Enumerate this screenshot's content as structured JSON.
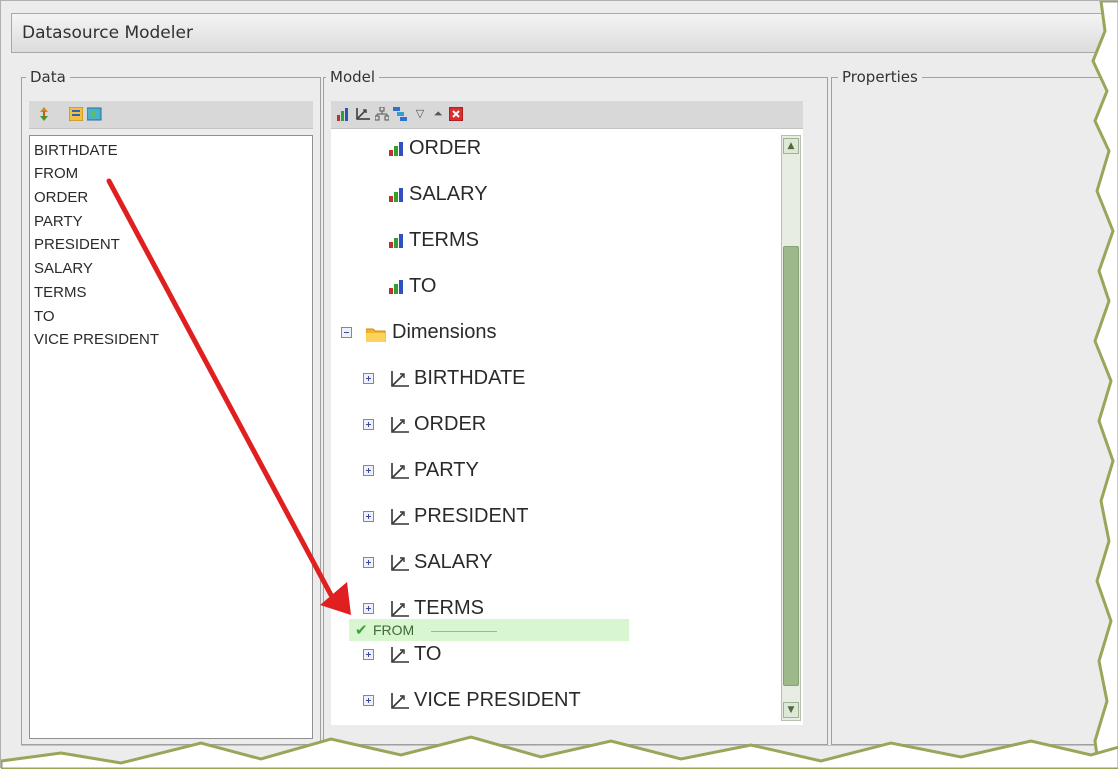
{
  "window": {
    "title": "Datasource Modeler"
  },
  "panels": {
    "data": {
      "label": "Data"
    },
    "model": {
      "label": "Model"
    },
    "properties": {
      "label": "Properties"
    }
  },
  "data_fields": [
    "BIRTHDATE",
    "FROM",
    "ORDER",
    "PARTY",
    "PRESIDENT",
    "SALARY",
    "TERMS",
    "TO",
    "VICE PRESIDENT"
  ],
  "model_tree": {
    "measures": [
      "ORDER",
      "SALARY",
      "TERMS",
      "TO"
    ],
    "dimensions_label": "Dimensions",
    "dimensions": [
      "BIRTHDATE",
      "ORDER",
      "PARTY",
      "PRESIDENT",
      "SALARY",
      "TERMS",
      "TO",
      "VICE PRESIDENT"
    ]
  },
  "drag": {
    "label": "FROM"
  },
  "colors": {
    "arrow": "#e02020",
    "drop_highlight": "#d8f6d0",
    "scrollbar": "#9db88a"
  }
}
